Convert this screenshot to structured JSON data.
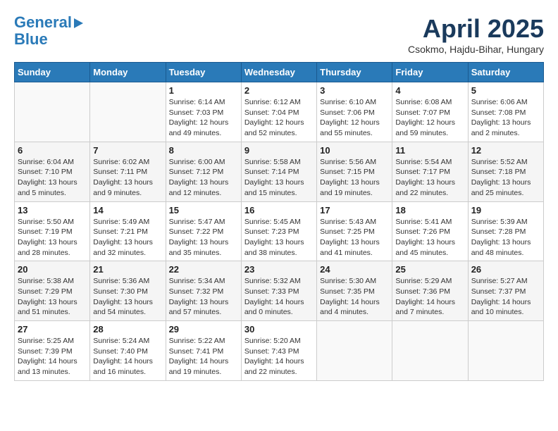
{
  "logo": {
    "line1": "General",
    "line2": "Blue"
  },
  "title": "April 2025",
  "subtitle": "Csokmo, Hajdu-Bihar, Hungary",
  "days_of_week": [
    "Sunday",
    "Monday",
    "Tuesday",
    "Wednesday",
    "Thursday",
    "Friday",
    "Saturday"
  ],
  "weeks": [
    [
      {
        "day": "",
        "info": ""
      },
      {
        "day": "",
        "info": ""
      },
      {
        "day": "1",
        "info": "Sunrise: 6:14 AM\nSunset: 7:03 PM\nDaylight: 12 hours\nand 49 minutes."
      },
      {
        "day": "2",
        "info": "Sunrise: 6:12 AM\nSunset: 7:04 PM\nDaylight: 12 hours\nand 52 minutes."
      },
      {
        "day": "3",
        "info": "Sunrise: 6:10 AM\nSunset: 7:06 PM\nDaylight: 12 hours\nand 55 minutes."
      },
      {
        "day": "4",
        "info": "Sunrise: 6:08 AM\nSunset: 7:07 PM\nDaylight: 12 hours\nand 59 minutes."
      },
      {
        "day": "5",
        "info": "Sunrise: 6:06 AM\nSunset: 7:08 PM\nDaylight: 13 hours\nand 2 minutes."
      }
    ],
    [
      {
        "day": "6",
        "info": "Sunrise: 6:04 AM\nSunset: 7:10 PM\nDaylight: 13 hours\nand 5 minutes."
      },
      {
        "day": "7",
        "info": "Sunrise: 6:02 AM\nSunset: 7:11 PM\nDaylight: 13 hours\nand 9 minutes."
      },
      {
        "day": "8",
        "info": "Sunrise: 6:00 AM\nSunset: 7:12 PM\nDaylight: 13 hours\nand 12 minutes."
      },
      {
        "day": "9",
        "info": "Sunrise: 5:58 AM\nSunset: 7:14 PM\nDaylight: 13 hours\nand 15 minutes."
      },
      {
        "day": "10",
        "info": "Sunrise: 5:56 AM\nSunset: 7:15 PM\nDaylight: 13 hours\nand 19 minutes."
      },
      {
        "day": "11",
        "info": "Sunrise: 5:54 AM\nSunset: 7:17 PM\nDaylight: 13 hours\nand 22 minutes."
      },
      {
        "day": "12",
        "info": "Sunrise: 5:52 AM\nSunset: 7:18 PM\nDaylight: 13 hours\nand 25 minutes."
      }
    ],
    [
      {
        "day": "13",
        "info": "Sunrise: 5:50 AM\nSunset: 7:19 PM\nDaylight: 13 hours\nand 28 minutes."
      },
      {
        "day": "14",
        "info": "Sunrise: 5:49 AM\nSunset: 7:21 PM\nDaylight: 13 hours\nand 32 minutes."
      },
      {
        "day": "15",
        "info": "Sunrise: 5:47 AM\nSunset: 7:22 PM\nDaylight: 13 hours\nand 35 minutes."
      },
      {
        "day": "16",
        "info": "Sunrise: 5:45 AM\nSunset: 7:23 PM\nDaylight: 13 hours\nand 38 minutes."
      },
      {
        "day": "17",
        "info": "Sunrise: 5:43 AM\nSunset: 7:25 PM\nDaylight: 13 hours\nand 41 minutes."
      },
      {
        "day": "18",
        "info": "Sunrise: 5:41 AM\nSunset: 7:26 PM\nDaylight: 13 hours\nand 45 minutes."
      },
      {
        "day": "19",
        "info": "Sunrise: 5:39 AM\nSunset: 7:28 PM\nDaylight: 13 hours\nand 48 minutes."
      }
    ],
    [
      {
        "day": "20",
        "info": "Sunrise: 5:38 AM\nSunset: 7:29 PM\nDaylight: 13 hours\nand 51 minutes."
      },
      {
        "day": "21",
        "info": "Sunrise: 5:36 AM\nSunset: 7:30 PM\nDaylight: 13 hours\nand 54 minutes."
      },
      {
        "day": "22",
        "info": "Sunrise: 5:34 AM\nSunset: 7:32 PM\nDaylight: 13 hours\nand 57 minutes."
      },
      {
        "day": "23",
        "info": "Sunrise: 5:32 AM\nSunset: 7:33 PM\nDaylight: 14 hours\nand 0 minutes."
      },
      {
        "day": "24",
        "info": "Sunrise: 5:30 AM\nSunset: 7:35 PM\nDaylight: 14 hours\nand 4 minutes."
      },
      {
        "day": "25",
        "info": "Sunrise: 5:29 AM\nSunset: 7:36 PM\nDaylight: 14 hours\nand 7 minutes."
      },
      {
        "day": "26",
        "info": "Sunrise: 5:27 AM\nSunset: 7:37 PM\nDaylight: 14 hours\nand 10 minutes."
      }
    ],
    [
      {
        "day": "27",
        "info": "Sunrise: 5:25 AM\nSunset: 7:39 PM\nDaylight: 14 hours\nand 13 minutes."
      },
      {
        "day": "28",
        "info": "Sunrise: 5:24 AM\nSunset: 7:40 PM\nDaylight: 14 hours\nand 16 minutes."
      },
      {
        "day": "29",
        "info": "Sunrise: 5:22 AM\nSunset: 7:41 PM\nDaylight: 14 hours\nand 19 minutes."
      },
      {
        "day": "30",
        "info": "Sunrise: 5:20 AM\nSunset: 7:43 PM\nDaylight: 14 hours\nand 22 minutes."
      },
      {
        "day": "",
        "info": ""
      },
      {
        "day": "",
        "info": ""
      },
      {
        "day": "",
        "info": ""
      }
    ]
  ]
}
